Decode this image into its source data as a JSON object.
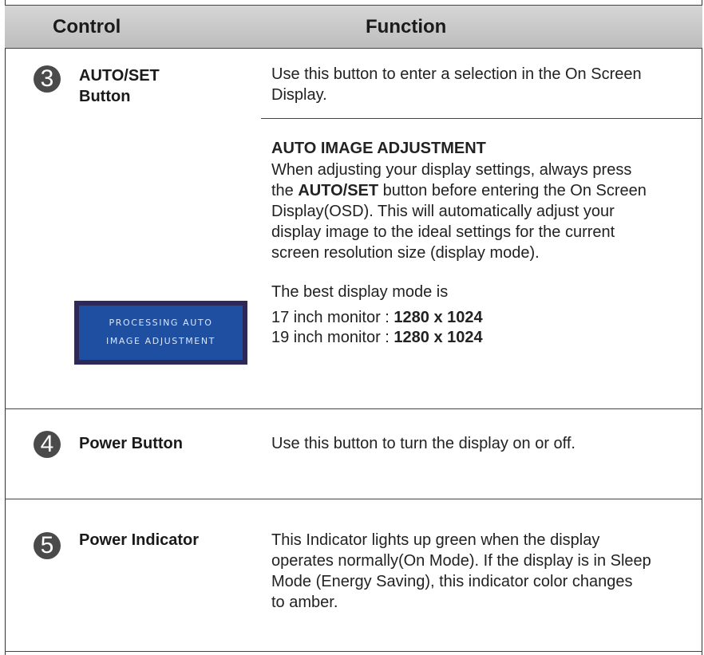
{
  "header": {
    "control": "Control",
    "function": "Function"
  },
  "rows": [
    {
      "number": "3",
      "control": [
        "AUTO/SET",
        "Button"
      ],
      "intro": [
        "Use this button to enter a selection in the On Screen",
        "Display."
      ],
      "subheading": "AUTO IMAGE ADJUSTMENT",
      "para_line1": "When adjusting your display settings, always press",
      "para_line2_a": "the ",
      "para_line2_bold": "AUTO/SET",
      "para_line2_b": " button before entering the On Screen",
      "para_rest": [
        "Display(OSD). This will automatically adjust your",
        "display image to the ideal settings for the current",
        "screen resolution size (display mode)."
      ],
      "best_mode": "The best display mode is",
      "mode1_label": "17 inch monitor : ",
      "mode1_value": "1280 x 1024",
      "mode2_label": "19 inch monitor : ",
      "mode2_value": "1280 x 1024",
      "osd": [
        "PROCESSING AUTO",
        "IMAGE ADJUSTMENT"
      ]
    },
    {
      "number": "4",
      "control": "Power Button",
      "text": "Use this button to turn the display on or off."
    },
    {
      "number": "5",
      "control": "Power Indicator",
      "text": [
        "This Indicator lights up green when the display",
        "operates normally(On Mode). If the display is in Sleep",
        "Mode (Energy Saving), this indicator color changes",
        "to amber."
      ]
    }
  ]
}
